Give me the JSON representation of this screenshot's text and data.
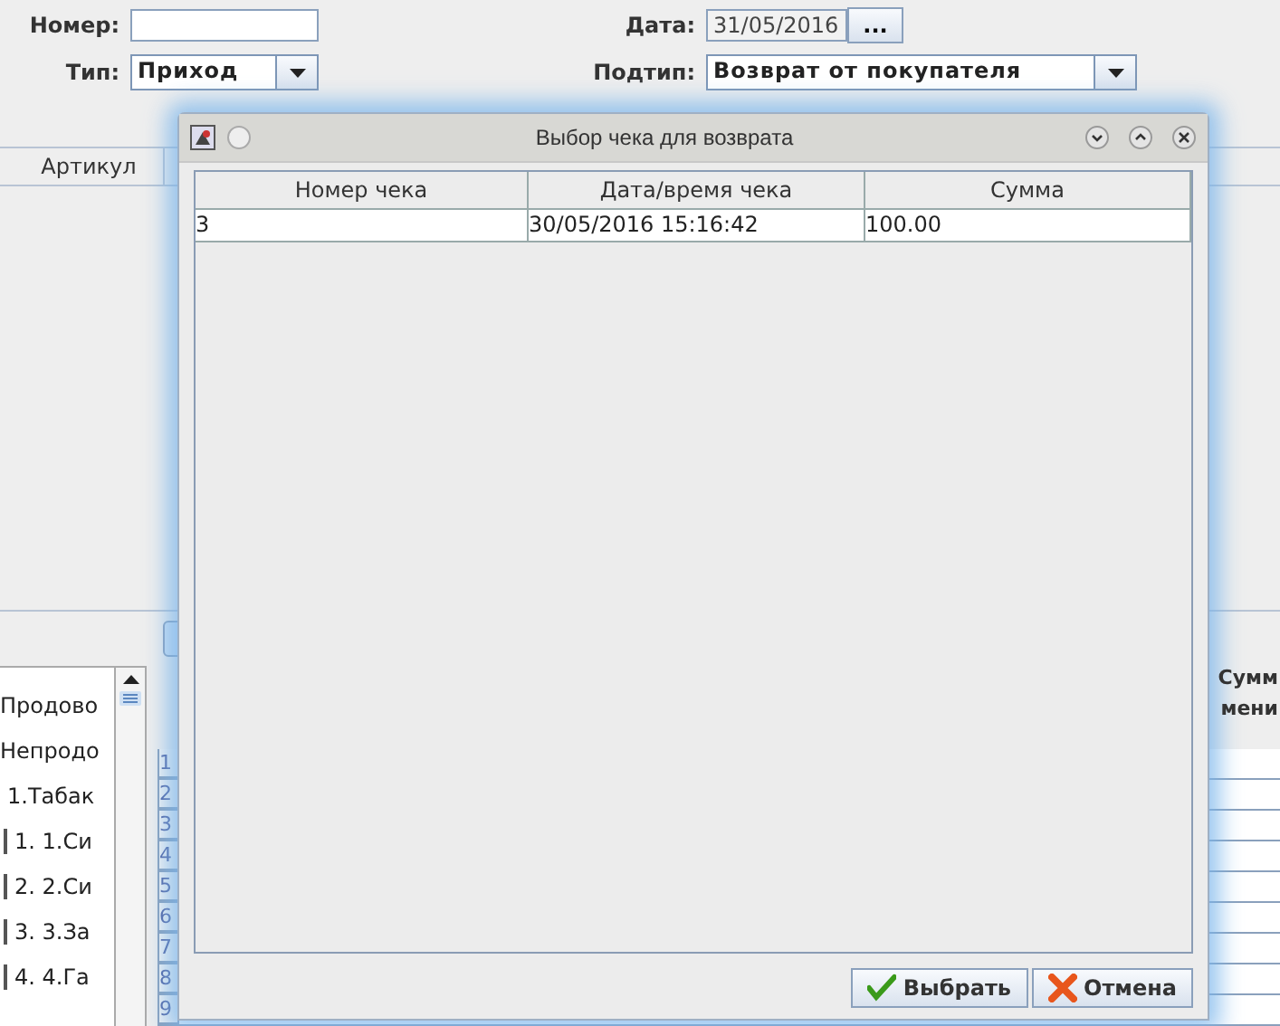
{
  "form": {
    "number_label": "Номер:",
    "date_label": "Дата:",
    "date_value": "31/05/2016",
    "date_button": "...",
    "type_label": "Тип:",
    "type_value": "Приход",
    "subtype_label": "Подтип:",
    "subtype_value": "Возврат от покупателя"
  },
  "items_table": {
    "columns": [
      "Артикул"
    ]
  },
  "tree": {
    "items": [
      {
        "label": "Продово"
      },
      {
        "label": "Непродо",
        "children": [
          {
            "label": "1.Табак",
            "children": [
              {
                "label": "1. 1.Си"
              },
              {
                "label": "2. 2.Си"
              },
              {
                "label": "3. 3.За"
              },
              {
                "label": "4. 4.Га"
              }
            ]
          }
        ]
      }
    ]
  },
  "grid": {
    "row_numbers": [
      "1",
      "2",
      "3",
      "4",
      "5",
      "6",
      "7",
      "8",
      "9"
    ],
    "headers": [
      "Сумм",
      "мени"
    ]
  },
  "dialog": {
    "title": "Выбор чека для возврата",
    "table": {
      "columns": [
        "Номер чека",
        "Дата/время чека",
        "Сумма"
      ],
      "rows": [
        [
          "3",
          "30/05/2016 15:16:42",
          "100.00"
        ]
      ]
    },
    "buttons": [
      {
        "label": "Выбрать",
        "kind": "ok"
      },
      {
        "label": "Отмена",
        "kind": "cancel"
      }
    ]
  }
}
